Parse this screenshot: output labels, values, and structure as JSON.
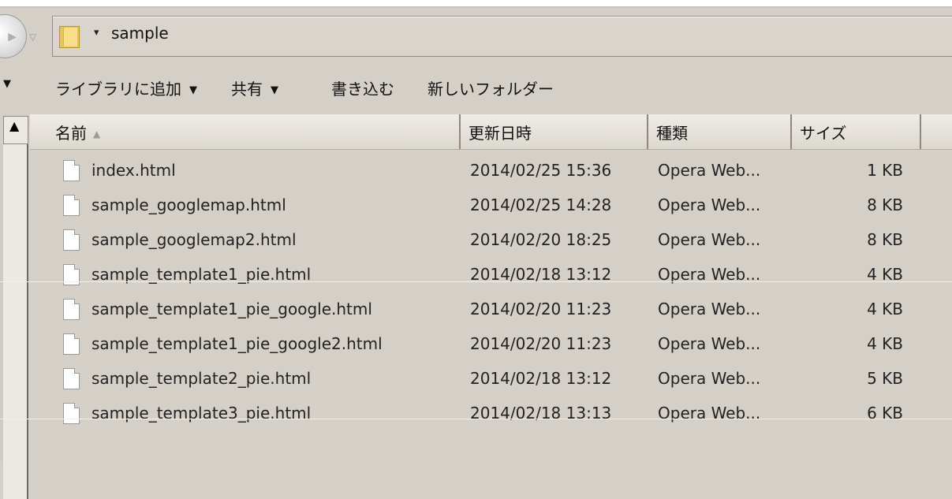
{
  "address": {
    "path": "sample",
    "dropdown_glyph": "▾",
    "history_glyph": "▽"
  },
  "toolbar": {
    "items": [
      {
        "label": "ライブラリに追加",
        "has_dropdown": true
      },
      {
        "label": "共有",
        "has_dropdown": true
      },
      {
        "label": "書き込む",
        "has_dropdown": false
      },
      {
        "label": "新しいフォルダー",
        "has_dropdown": false
      }
    ],
    "dropdown_glyph": "▼"
  },
  "columns": {
    "name": "名前",
    "date": "更新日時",
    "type": "種類",
    "size": "サイズ",
    "sort_glyph": "▲"
  },
  "files": [
    {
      "name": "index.html",
      "date": "2014/02/25 15:36",
      "type": "Opera Web...",
      "size": "1 KB"
    },
    {
      "name": "sample_googlemap.html",
      "date": "2014/02/25 14:28",
      "type": "Opera Web...",
      "size": "8 KB"
    },
    {
      "name": "sample_googlemap2.html",
      "date": "2014/02/20 18:25",
      "type": "Opera Web...",
      "size": "8 KB"
    },
    {
      "name": "sample_template1_pie.html",
      "date": "2014/02/18 13:12",
      "type": "Opera Web...",
      "size": "4 KB"
    },
    {
      "name": "sample_template1_pie_google.html",
      "date": "2014/02/20 11:23",
      "type": "Opera Web...",
      "size": "4 KB"
    },
    {
      "name": "sample_template1_pie_google2.html",
      "date": "2014/02/20 11:23",
      "type": "Opera Web...",
      "size": "4 KB"
    },
    {
      "name": "sample_template2_pie.html",
      "date": "2014/02/18 13:12",
      "type": "Opera Web...",
      "size": "5 KB"
    },
    {
      "name": "sample_template3_pie.html",
      "date": "2014/02/18 13:13",
      "type": "Opera Web...",
      "size": "6 KB"
    }
  ],
  "colors": {
    "window_bg": "#d4d0c8",
    "folder": "#e9c45a"
  }
}
